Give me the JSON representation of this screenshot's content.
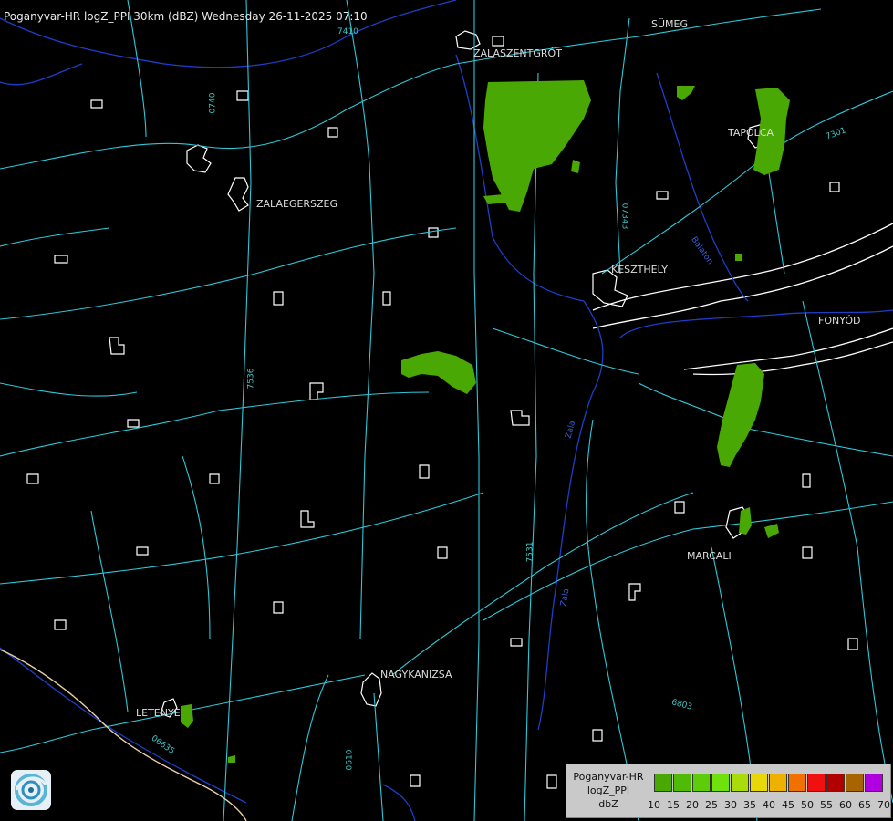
{
  "header": {
    "title": "Poganyvar-HR logZ_PPI 30km (dBZ) Wednesday 26-11-2025 07:10"
  },
  "cities": [
    {
      "id": "sumeg",
      "name": "SÜMEG"
    },
    {
      "id": "zalaszentgrot",
      "name": "ZALASZENTGRÓT"
    },
    {
      "id": "tapolca",
      "name": "TAPOLCA"
    },
    {
      "id": "zalaegerszeg",
      "name": "ZALAEGERSZEG"
    },
    {
      "id": "keszthely",
      "name": "KESZTHELY"
    },
    {
      "id": "fonyod",
      "name": "FONYÓD"
    },
    {
      "id": "marcali",
      "name": "MARCALI"
    },
    {
      "id": "nagykanizsa",
      "name": "NAGYKANIZSA"
    },
    {
      "id": "letenye",
      "name": "LETENYE"
    }
  ],
  "road_labels": [
    "7410",
    "0740",
    "7301",
    "07343",
    "7536",
    "7531",
    "6803",
    "06635",
    "0610"
  ],
  "water_labels": [
    "Zala",
    "Zala",
    "Balaton"
  ],
  "legend": {
    "line1": "Poganyvar-HR",
    "line2": "logZ_PPI",
    "line3": "dbZ",
    "ticks": [
      "10",
      "15",
      "20",
      "25",
      "30",
      "35",
      "40",
      "45",
      "50",
      "55",
      "60",
      "65",
      "70"
    ],
    "colors": [
      "#4aa805",
      "#4fbb06",
      "#5ccd08",
      "#6ee20a",
      "#aadc0c",
      "#e8d80a",
      "#f0b000",
      "#f07000",
      "#f01010",
      "#b00000",
      "#a86400",
      "#b000e0",
      "#a0a0ff"
    ]
  },
  "echo_color": "#4aa805",
  "colors": {
    "road": "#2ec8d8",
    "water": "#1e3ec8",
    "boundary": "#ffffff"
  }
}
